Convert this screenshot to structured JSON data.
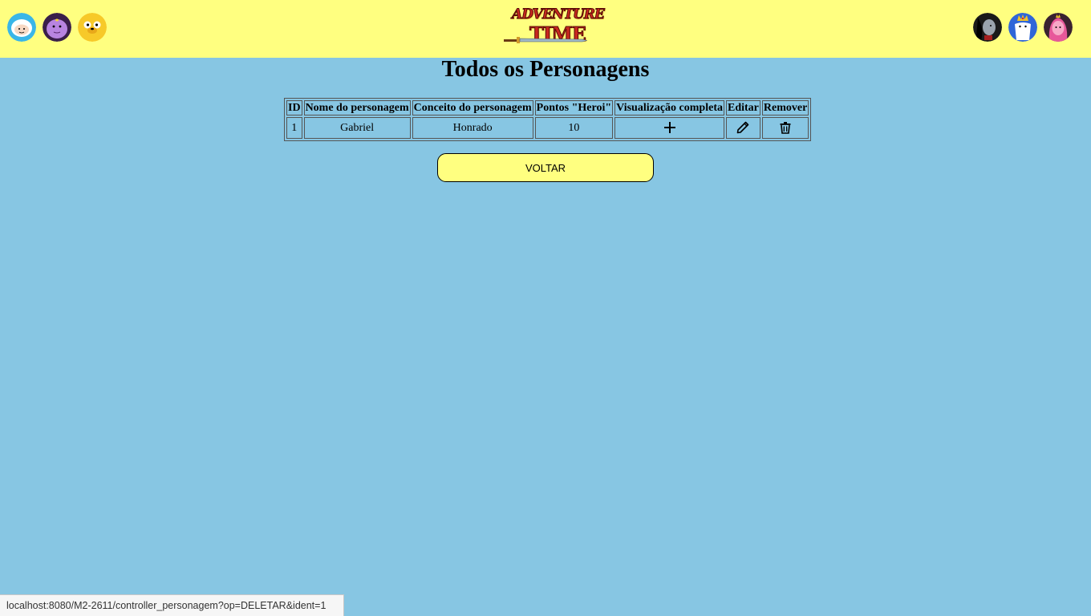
{
  "header": {
    "left_avatars": [
      "finn-avatar-icon",
      "lumpy-space-princess-avatar-icon",
      "jake-avatar-icon"
    ],
    "right_avatars": [
      "marceline-avatar-icon",
      "ice-king-avatar-icon",
      "princess-bubblegum-avatar-icon"
    ],
    "logo": {
      "line1": "ADVENTURE",
      "line2": "TIME"
    },
    "background": "#ffff80"
  },
  "page": {
    "title": "Todos os Personagens",
    "background": "#87c6e3"
  },
  "table": {
    "headers": [
      "ID",
      "Nome do personagem",
      "Conceito do personagem",
      "Pontos \"Heroi\"",
      "Visualização completa",
      "Editar",
      "Remover"
    ],
    "rows": [
      {
        "id": "1",
        "nome": "Gabriel",
        "conceito": "Honrado",
        "pontos": "10",
        "view_icon": "plus-icon",
        "edit_icon": "pencil-icon",
        "remove_icon": "trash-icon"
      }
    ]
  },
  "actions": {
    "voltar_label": "VOLTAR"
  },
  "status_bar": {
    "url": "localhost:8080/M2-2611/controller_personagem?op=DELETAR&ident=1"
  }
}
